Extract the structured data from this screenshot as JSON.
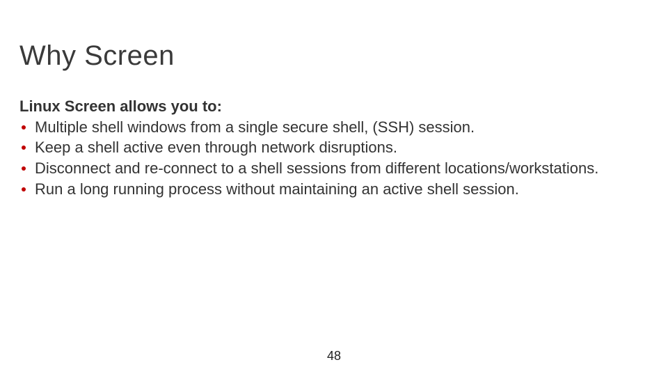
{
  "slide": {
    "title": "Why Screen",
    "subhead": "Linux Screen allows you to:",
    "bullets": [
      "Multiple shell windows from a single secure shell, (SSH) session.",
      "Keep a shell active even through network disruptions.",
      "Disconnect and re-connect to a shell sessions from different locations/workstations.",
      "Run a long running process without maintaining an active shell session."
    ],
    "page_number": "48"
  },
  "colors": {
    "bullet": "#c00000"
  }
}
